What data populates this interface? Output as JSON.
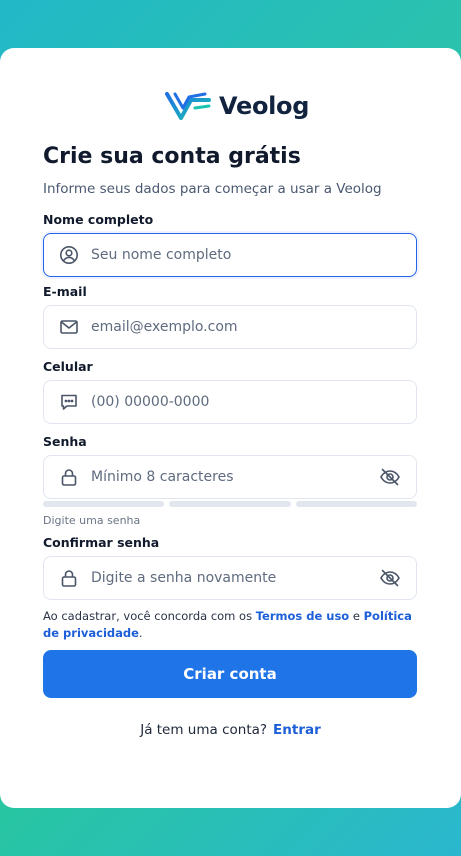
{
  "brand": {
    "name": "Veolog"
  },
  "header": {
    "title": "Crie sua conta grátis",
    "subtitle": "Informe seus dados para começar a usar a Veolog"
  },
  "form": {
    "name": {
      "label": "Nome completo",
      "placeholder": "Seu nome completo",
      "icon": "user-circle-icon"
    },
    "email": {
      "label": "E-mail",
      "placeholder": "email@exemplo.com",
      "icon": "mail-icon"
    },
    "phone": {
      "label": "Celular",
      "placeholder": "(00) 00000-0000",
      "icon": "message-icon"
    },
    "password": {
      "label": "Senha",
      "placeholder": "Mínimo 8 caracteres",
      "icon": "lock-icon",
      "toggle_icon": "eye-off-icon",
      "hint": "Digite uma senha",
      "strength_filled": 0
    },
    "confirm": {
      "label": "Confirmar senha",
      "placeholder": "Digite a senha novamente",
      "icon": "lock-icon",
      "toggle_icon": "eye-off-icon"
    },
    "terms": {
      "prefix": "Ao cadastrar, você concorda com os ",
      "terms_link": "Termos de uso",
      "conjunction": " e ",
      "privacy_link": "Política de privacidade",
      "suffix": "."
    },
    "submit_label": "Criar conta"
  },
  "footer": {
    "question": "Já tem uma conta?",
    "login_link": "Entrar"
  },
  "colors": {
    "primary": "#1f74e8",
    "link": "#1d5fd8",
    "text": "#111a2c",
    "border": "#e1e6ee",
    "focus": "#2563eb"
  }
}
